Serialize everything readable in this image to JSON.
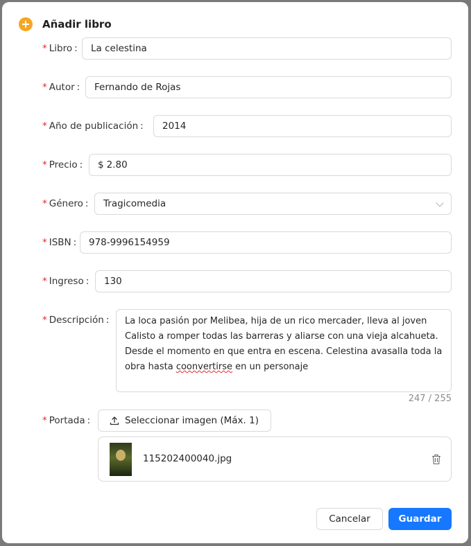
{
  "dialog": {
    "title": "Añadir libro",
    "accent_color": "#f5a623"
  },
  "form": {
    "libro": {
      "label": "Libro",
      "value": "La celestina"
    },
    "autor": {
      "label": "Autor",
      "value": "Fernando de Rojas"
    },
    "anio": {
      "label": "Año de publicación",
      "value": "2014"
    },
    "precio": {
      "label": "Precio",
      "prefix": "$",
      "value": "2.80"
    },
    "genero": {
      "label": "Género",
      "value": "Tragicomedia"
    },
    "isbn": {
      "label": "ISBN",
      "value": "978-9996154959"
    },
    "ingreso": {
      "label": "Ingreso",
      "value": "130"
    },
    "descripcion": {
      "label": "Descripción",
      "value_main": "La loca pasión por Melibea, hija de un rico mercader, lleva al joven Calisto a romper todas las barreras y aliarse con una vieja alcahueta. Desde el momento en que entra en escena. Celestina avasalla toda la obra hasta ",
      "value_misspelled": "coonvertirse",
      "value_end": " en un personaje",
      "counter": "247 / 255"
    },
    "portada": {
      "label": "Portada",
      "upload_label": "Seleccionar imagen (Máx. 1)",
      "file_name": "115202400040.jpg"
    },
    "required_marker": "*",
    "colon": ":"
  },
  "actions": {
    "cancel": "Cancelar",
    "save": "Guardar",
    "save_color": "#1677ff"
  }
}
